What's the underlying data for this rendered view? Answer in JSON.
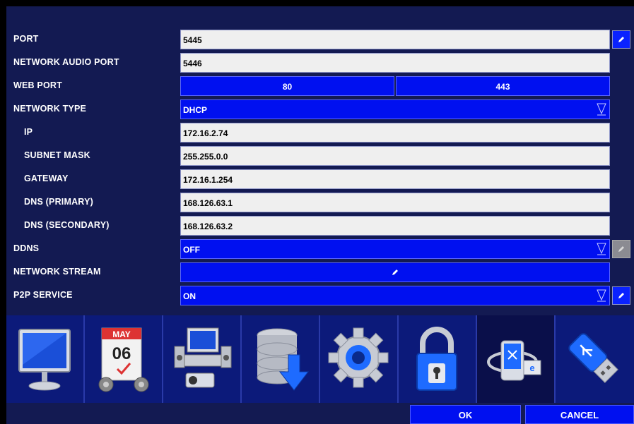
{
  "settings": [
    {
      "label": "PORT",
      "value": "5445",
      "kind": "text",
      "side": "edit"
    },
    {
      "label": "NETWORK AUDIO PORT",
      "value": "5446",
      "kind": "text"
    },
    {
      "label": "WEB PORT",
      "kind": "split",
      "values": [
        "80",
        "443"
      ]
    },
    {
      "label": "NETWORK TYPE",
      "value": "DHCP",
      "kind": "dropdown"
    },
    {
      "label": "IP",
      "value": "172.16.2.74",
      "kind": "text",
      "indent": true
    },
    {
      "label": "SUBNET MASK",
      "value": "255.255.0.0",
      "kind": "text",
      "indent": true
    },
    {
      "label": "GATEWAY",
      "value": "172.16.1.254",
      "kind": "text",
      "indent": true
    },
    {
      "label": "DNS (PRIMARY)",
      "value": "168.126.63.1",
      "kind": "text",
      "indent": true
    },
    {
      "label": "DNS (SECONDARY)",
      "value": "168.126.63.2",
      "kind": "text",
      "indent": true
    },
    {
      "label": "DDNS",
      "value": "OFF",
      "kind": "dropdown",
      "side": "edit-disabled"
    },
    {
      "label": "NETWORK STREAM",
      "kind": "button"
    },
    {
      "label": "P2P SERVICE",
      "value": "ON",
      "kind": "dropdown",
      "side": "edit"
    }
  ],
  "menu_icons": [
    "display-monitor-icon",
    "calendar-icon",
    "device-icon",
    "storage-backup-icon",
    "gear-icon",
    "lock-icon",
    "network-icon",
    "usb-icon"
  ],
  "selected_icon": "network-icon",
  "calendar": {
    "month": "MAY",
    "day": "06"
  },
  "footer": {
    "ok_label": "OK",
    "cancel_label": "CANCEL"
  },
  "colors": {
    "background": "#131a52",
    "accent": "#0010f0",
    "field": "#efefef"
  }
}
